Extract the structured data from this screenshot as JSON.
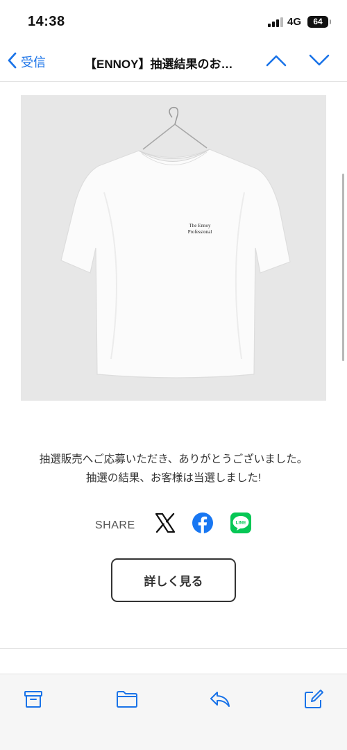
{
  "status_bar": {
    "time": "14:38",
    "network": "4G",
    "battery": "64"
  },
  "nav": {
    "back_label": "受信",
    "title": "【ENNOY】抽選結果のお…"
  },
  "product": {
    "shirt_print_line1": "The Ennoy",
    "shirt_print_line2": "Professional"
  },
  "message": {
    "line1": "抽選販売へご応募いただき、ありがとうございました。",
    "line2": "抽選の結果、お客様は当選しました!"
  },
  "share": {
    "label": "SHARE",
    "icons": [
      "x-icon",
      "facebook-icon",
      "line-icon"
    ],
    "line_text": "LINE"
  },
  "details_button": {
    "label": "詳しく見る"
  },
  "colors": {
    "accent": "#1a73e8",
    "facebook": "#1877f2",
    "line": "#06c755"
  }
}
